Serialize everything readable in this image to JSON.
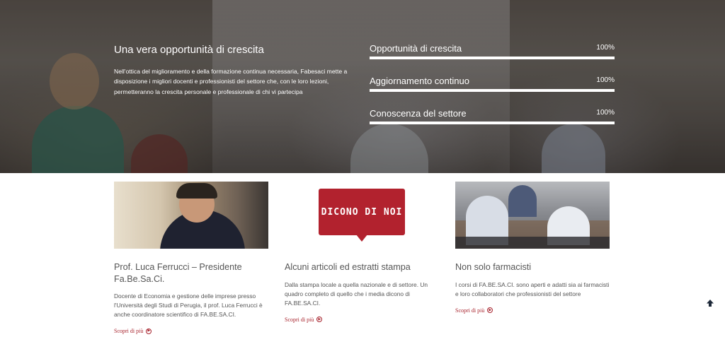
{
  "hero": {
    "title": "Una vera opportunità di crescita",
    "text": "Nell'ottica del miglioramento e della formazione continua necessaria, Fabesaci mette a disposizione i migliori docenti e professionisti del settore che, con le loro lezioni, permetteranno la crescita personale e professionale di chi vi partecipa",
    "skills": [
      {
        "label": "Opportunità di crescita",
        "percent_label": "100%",
        "value": 100
      },
      {
        "label": "Aggiornamento continuo",
        "percent_label": "100%",
        "value": 100
      },
      {
        "label": "Conoscenza del settore",
        "percent_label": "100%",
        "value": 100
      }
    ]
  },
  "cards": [
    {
      "title": "Prof. Luca Ferrucci – Presidente Fa.Be.Sa.Ci.",
      "text": "Docente di Economia e gestione delle imprese presso l'Università degli Studi di Perugia, il prof. Luca Ferrucci è anche coordinatore scientifico di FA.BE.SA.CI.",
      "link": "Scopri di più"
    },
    {
      "badge": "DICONO DI NOI",
      "title": "Alcuni articoli ed estratti stampa",
      "text": "Dalla stampa locale a quella nazionale e di settore. Un quadro completo di quello che i media dicono di FA.BE.SA.CI.",
      "link": "Scopri di più"
    },
    {
      "title": "Non solo farmacisti",
      "text": "I corsi di FA.BE.SA.CI. sono aperti e adatti sia ai farmacisti e loro collaboratori che professionisti del settore",
      "link": "Scopri di più"
    }
  ],
  "colors": {
    "accent": "#a8242e",
    "badge": "#b2222e"
  },
  "icons": {
    "link_arrow": "circle-arrow-right-icon",
    "scroll_top": "arrow-up-icon"
  }
}
